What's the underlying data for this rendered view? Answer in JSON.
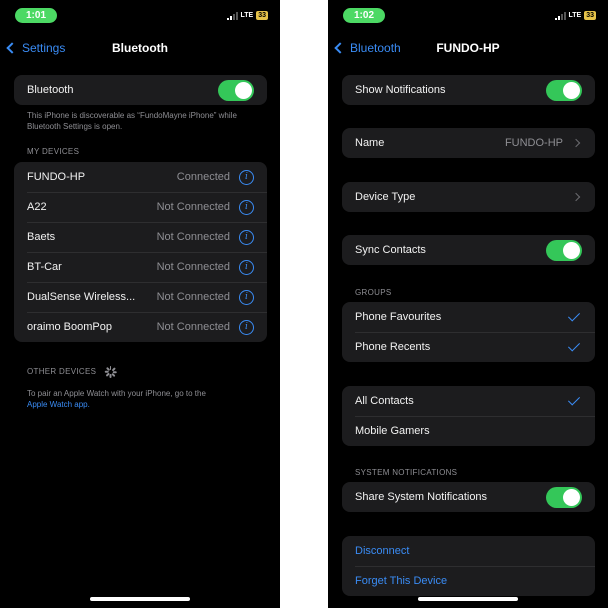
{
  "left": {
    "status": {
      "time": "1:01",
      "network": "LTE",
      "battery": "33"
    },
    "nav": {
      "back_label": "Settings",
      "title": "Bluetooth"
    },
    "bluetooth_label": "Bluetooth",
    "bluetooth_on": true,
    "discoverable_text": "This iPhone is discoverable as “FundoMayne iPhone” while Bluetooth Settings is open.",
    "my_devices_header": "MY DEVICES",
    "devices": [
      {
        "name": "FUNDO-HP",
        "status": "Connected"
      },
      {
        "name": "A22",
        "status": "Not Connected"
      },
      {
        "name": "Baets",
        "status": "Not Connected"
      },
      {
        "name": "BT-Car",
        "status": "Not Connected"
      },
      {
        "name": "DualSense Wireless...",
        "status": "Not Connected"
      },
      {
        "name": "oraimo BoomPop",
        "status": "Not Connected"
      }
    ],
    "other_devices_header": "OTHER DEVICES",
    "pair_text": "To pair an Apple Watch with your iPhone, go to the",
    "pair_link": "Apple Watch app."
  },
  "right": {
    "status": {
      "time": "1:02",
      "network": "LTE",
      "battery": "33"
    },
    "nav": {
      "back_label": "Bluetooth",
      "title": "FUNDO-HP"
    },
    "show_notifications_label": "Show Notifications",
    "show_notifications_on": true,
    "name_label": "Name",
    "name_value": "FUNDO-HP",
    "device_type_label": "Device Type",
    "sync_contacts_label": "Sync Contacts",
    "sync_contacts_on": true,
    "groups_header": "GROUPS",
    "groups": [
      {
        "label": "Phone Favourites",
        "checked": true
      },
      {
        "label": "Phone Recents",
        "checked": true
      }
    ],
    "contacts": [
      {
        "label": "All Contacts",
        "checked": true
      },
      {
        "label": "Mobile Gamers",
        "checked": false
      }
    ],
    "system_notifications_header": "SYSTEM NOTIFICATIONS",
    "share_system_notifications_label": "Share System Notifications",
    "share_system_notifications_on": true,
    "disconnect_label": "Disconnect",
    "forget_label": "Forget This Device"
  },
  "colors": {
    "accent": "#3a8cf5",
    "toggle_on": "#34c759",
    "cell": "#1c1c1e",
    "time_pill": "#4cd964"
  }
}
